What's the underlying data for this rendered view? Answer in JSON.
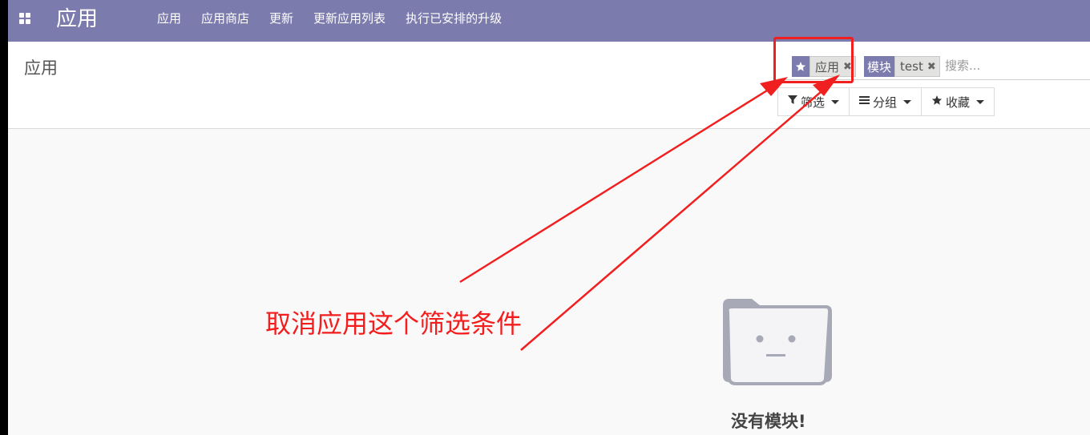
{
  "topnav": {
    "brand": "应用",
    "menu": [
      "应用",
      "应用商店",
      "更新",
      "更新应用列表",
      "执行已安排的升级"
    ]
  },
  "control_panel": {
    "breadcrumb": "应用",
    "search": {
      "facets": [
        {
          "icon": "star-icon",
          "value": "应用"
        },
        {
          "label": "模块",
          "value": "test"
        }
      ],
      "placeholder": "搜索..."
    },
    "buttons": {
      "filter": "筛选",
      "group_by": "分组",
      "favorites": "收藏"
    }
  },
  "empty_state": {
    "title": "没有模块!"
  },
  "annotation": {
    "text": "取消应用这个筛选条件",
    "color": "#f41d1d"
  },
  "colors": {
    "brand": "#7c7bad",
    "annotation": "#f02020"
  }
}
